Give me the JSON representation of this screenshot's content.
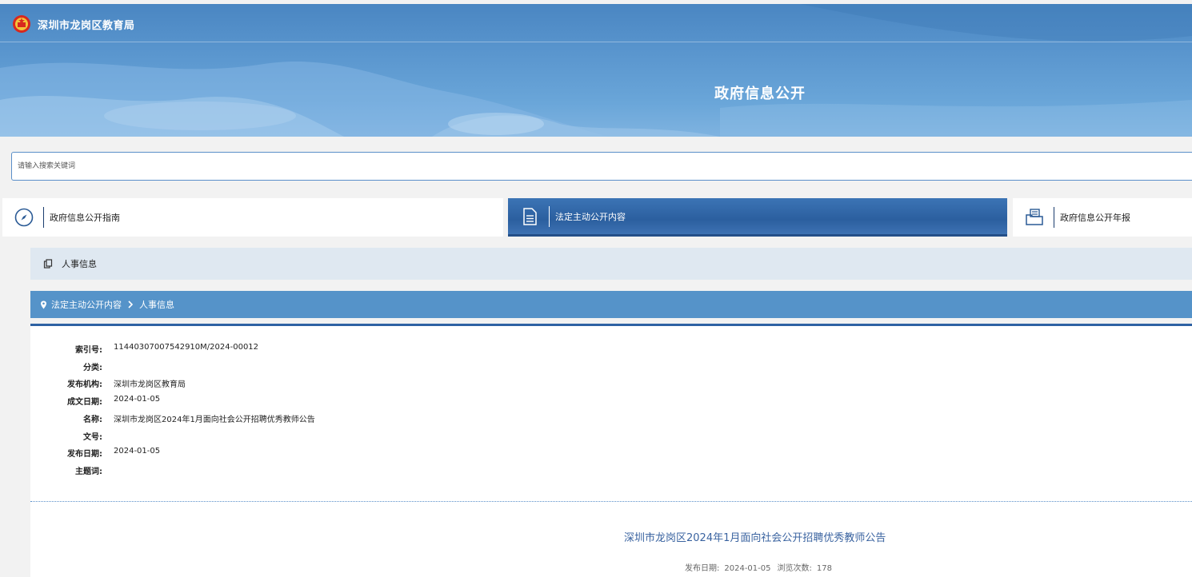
{
  "header": {
    "org_name": "深圳市龙岗区教育局",
    "banner_title": "政府信息公开"
  },
  "search": {
    "placeholder": "请输入搜索关键词"
  },
  "nav": {
    "tabs": [
      {
        "label": "政府信息公开指南",
        "icon": "compass-icon"
      },
      {
        "label": "法定主动公开内容",
        "icon": "document-icon",
        "active": true
      },
      {
        "label": "政府信息公开年报",
        "icon": "report-folder-icon"
      }
    ]
  },
  "category": {
    "label": "人事信息"
  },
  "breadcrumb": {
    "items": [
      "法定主动公开内容",
      "人事信息"
    ]
  },
  "meta": [
    {
      "key": "索引号:",
      "value": "11440307007542910M/2024-00012"
    },
    {
      "key": "分类:",
      "value": ""
    },
    {
      "key": "发布机构:",
      "value": "深圳市龙岗区教育局"
    },
    {
      "key": "成文日期:",
      "value": "2024-01-05"
    },
    {
      "key": "名称:",
      "value": "深圳市龙岗区2024年1月面向社会公开招聘优秀教师公告"
    },
    {
      "key": "文号:",
      "value": ""
    },
    {
      "key": "发布日期:",
      "value": "2024-01-05"
    },
    {
      "key": "主题词:",
      "value": ""
    }
  ],
  "document": {
    "title": "深圳市龙岗区2024年1月面向社会公开招聘优秀教师公告",
    "publish_label": "发布日期:",
    "publish_date": "2024-01-05",
    "views_label": "浏览次数:",
    "views": "178"
  },
  "colors": {
    "banner": "#5b97cf",
    "active_tab": "#2b5f9f",
    "breadcrumb": "#5593c9",
    "category_bg": "#dfe8f1",
    "doc_title": "#3a63a0"
  }
}
